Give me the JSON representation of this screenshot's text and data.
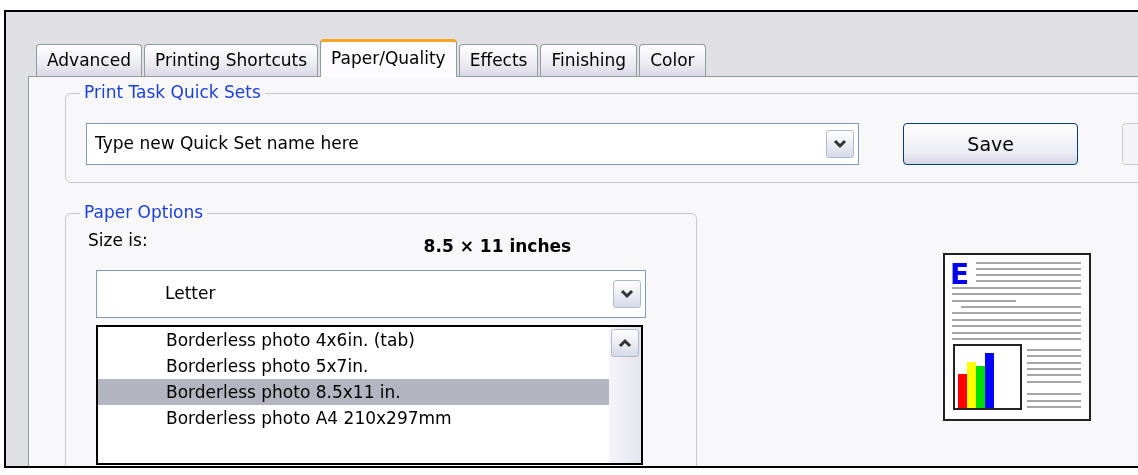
{
  "tabs": [
    {
      "label": "Advanced",
      "selected": false
    },
    {
      "label": "Printing Shortcuts",
      "selected": false
    },
    {
      "label": "Paper/Quality",
      "selected": true
    },
    {
      "label": "Effects",
      "selected": false
    },
    {
      "label": "Finishing",
      "selected": false
    },
    {
      "label": "Color",
      "selected": false
    }
  ],
  "quick_sets": {
    "legend": "Print Task Quick Sets",
    "value": "Type new Quick Set name here",
    "save_button": "Save"
  },
  "paper_options": {
    "legend": "Paper Options",
    "size_label": "Size is:",
    "size_value": "8.5 × 11 inches",
    "selected_size": "Letter",
    "dropdown_items": [
      {
        "label": "Borderless photo 4x6in. (tab)",
        "selected": false
      },
      {
        "label": "Borderless photo 5x7in.",
        "selected": false
      },
      {
        "label": "Borderless photo 8.5x11 in.",
        "selected": true
      },
      {
        "label": "Borderless photo A4 210x297mm",
        "selected": false
      }
    ]
  },
  "preview": {
    "letter": "E"
  }
}
